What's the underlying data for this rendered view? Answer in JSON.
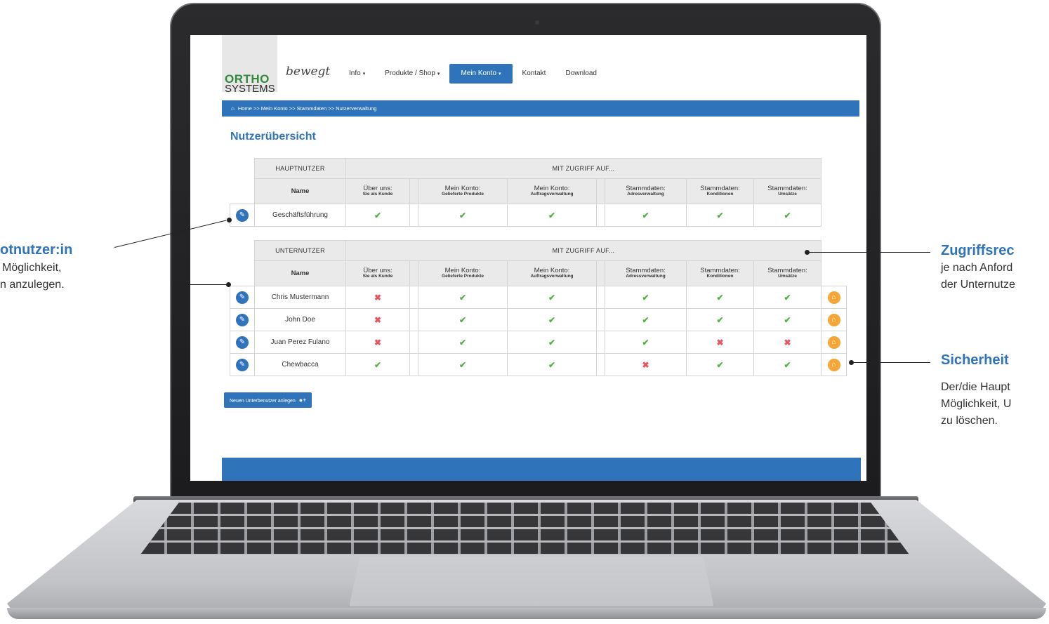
{
  "annotations": {
    "main_user_title": "otnutzer:in",
    "main_user_text_1": "Möglichkeit,",
    "main_user_text_2": "n anzulegen.",
    "access_title": "Zugriffsrec",
    "access_text_1": "je nach Anford",
    "access_text_2": "der Unternutze",
    "security_title": "Sicherheit",
    "security_text_1": "Der/die Haupt",
    "security_text_2": "Möglichkeit, U",
    "security_text_3": "zu löschen."
  },
  "site": {
    "logo_ortho": "ORTHO",
    "logo_systems": "SYSTEMS",
    "logo_tagline": "bewegt",
    "nav": [
      {
        "label": "Info",
        "dropdown": true,
        "active": false
      },
      {
        "label": "Produkte / Shop",
        "dropdown": true,
        "active": false
      },
      {
        "label": "Mein Konto",
        "dropdown": true,
        "active": true
      },
      {
        "label": "Kontakt",
        "dropdown": false,
        "active": false
      },
      {
        "label": "Download",
        "dropdown": false,
        "active": false
      }
    ],
    "breadcrumb": "Home >> Mein Konto >> Stammdaten >> Nutzerverwaltung",
    "page_title": "Nutzerübersicht",
    "new_user_button": "Neuen Unterbenutzer anlegen",
    "colors": {
      "primary": "#2f73bb",
      "check": "#52b246",
      "cross": "#e9545e",
      "delete": "#f5a637",
      "logo_green": "#2f8a3e"
    }
  },
  "main_table": {
    "group_label": "HAUPTNUTZER",
    "access_label": "MIT ZUGRIFF AUF...",
    "name_header": "Name",
    "columns_a": [
      {
        "main": "Über uns:",
        "sub": "Sie als Kunde"
      }
    ],
    "columns_b": [
      {
        "main": "Mein Konto:",
        "sub": "Gelieferte Produkte"
      },
      {
        "main": "Mein Konto:",
        "sub": "Auftragsverwaltung"
      }
    ],
    "columns_c": [
      {
        "main": "Stammdaten:",
        "sub": "Adresverwaltung"
      },
      {
        "main": "Stammdaten:",
        "sub": "Konditionen"
      },
      {
        "main": "Stammdaten:",
        "sub": "Umsätze"
      }
    ],
    "rows": [
      {
        "name": "Geschäftsführung",
        "access": [
          true,
          true,
          true,
          true,
          true,
          true
        ]
      }
    ]
  },
  "sub_table": {
    "group_label": "UNTERNUTZER",
    "access_label": "MIT ZUGRIFF AUF...",
    "name_header": "Name",
    "columns_a": [
      {
        "main": "Über uns:",
        "sub": "Sie als Kunde"
      }
    ],
    "columns_b": [
      {
        "main": "Mein Konto:",
        "sub": "Gelieferte Produkte"
      },
      {
        "main": "Mein Konto:",
        "sub": "Auftragsverwaltung"
      }
    ],
    "columns_c": [
      {
        "main": "Stammdaten:",
        "sub": "Adressverwaltung"
      },
      {
        "main": "Stammdaten:",
        "sub": "Konditionen"
      },
      {
        "main": "Stammdaten:",
        "sub": "Umsätze"
      }
    ],
    "rows": [
      {
        "name": "Chris Mustermann",
        "access": [
          false,
          true,
          true,
          true,
          true,
          true
        ]
      },
      {
        "name": "John Doe",
        "access": [
          false,
          true,
          true,
          true,
          true,
          true
        ]
      },
      {
        "name": "Juan Perez Fulano",
        "access": [
          false,
          true,
          true,
          true,
          false,
          false
        ]
      },
      {
        "name": "Chewbacca",
        "access": [
          true,
          true,
          true,
          false,
          true,
          true
        ]
      }
    ]
  },
  "icons": {
    "edit": "edit-pencil-icon",
    "delete": "trash-icon",
    "home": "home-icon",
    "add_user": "add-user-icon",
    "check": "check-icon",
    "cross": "cross-icon"
  }
}
